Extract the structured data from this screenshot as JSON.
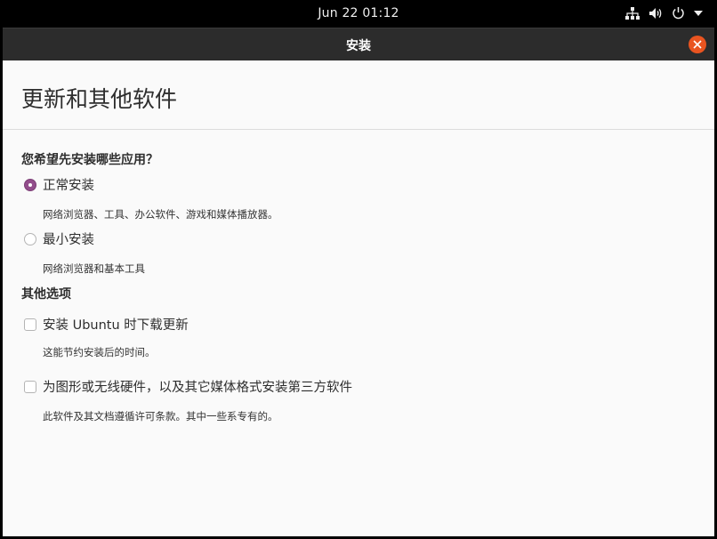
{
  "topbar": {
    "clock": "Jun 22  01:12",
    "icons": [
      "network-icon",
      "volume-icon",
      "power-icon",
      "menu-arrow-icon"
    ]
  },
  "window": {
    "title": "安装",
    "close_icon": "close-icon",
    "accent_color": "#e95420"
  },
  "page": {
    "title": "更新和其他软件",
    "install_question": "您希望先安装哪些应用？",
    "normal_install": {
      "label": "正常安装",
      "description": "网络浏览器、工具、办公软件、游戏和媒体播放器。",
      "selected": true
    },
    "minimal_install": {
      "label": "最小安装",
      "description": "网络浏览器和基本工具",
      "selected": false
    },
    "other_options_heading": "其他选项",
    "download_updates": {
      "label": "安装 Ubuntu 时下载更新",
      "description": "这能节约安装后的时间。",
      "checked": false
    },
    "third_party": {
      "label": "为图形或无线硬件，以及其它媒体格式安装第三方软件",
      "description": "此软件及其文档遵循许可条款。其中一些系专有的。",
      "checked": false
    },
    "radio_color": "#924d8b"
  }
}
